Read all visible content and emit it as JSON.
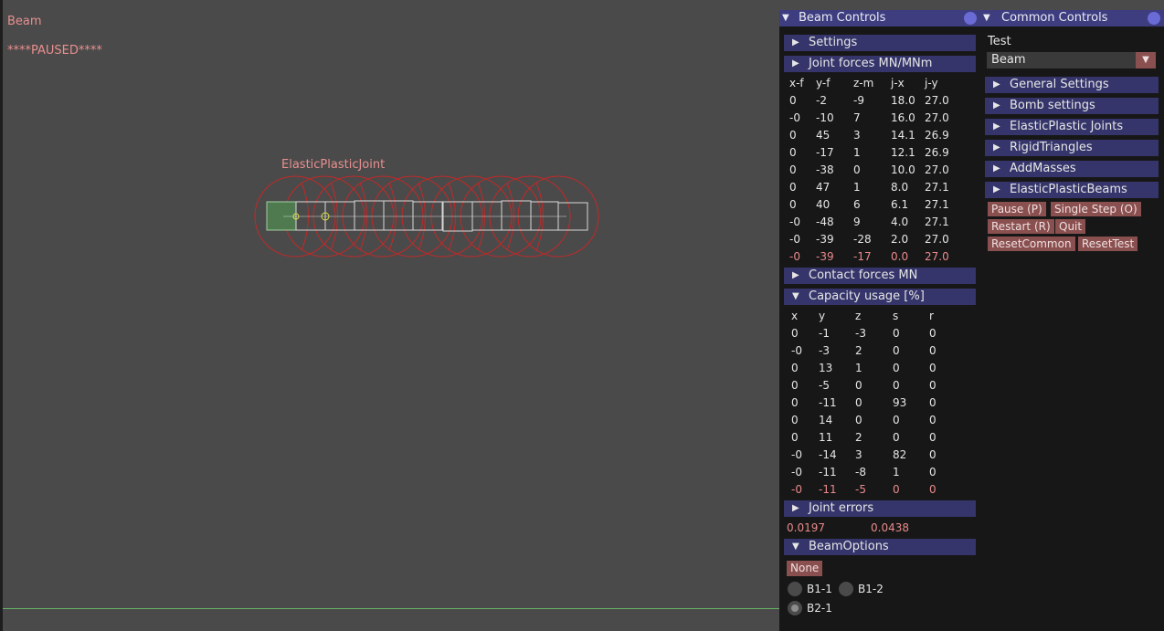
{
  "overlay": {
    "scene_label": "Beam",
    "paused_label": "****PAUSED****",
    "joint_label": "ElasticPlasticJoint"
  },
  "beam_controls": {
    "title": "Beam Controls",
    "settings": "Settings",
    "joint_forces": "Joint forces MN/MNm",
    "joint_forces_headers": [
      "x-f",
      "y-f",
      "z-m",
      "j-x",
      "j-y"
    ],
    "joint_forces_rows": [
      [
        "0",
        "-2",
        "-9",
        "18.0",
        "27.0"
      ],
      [
        "-0",
        "-10",
        "7",
        "16.0",
        "27.0"
      ],
      [
        "0",
        "45",
        "3",
        "14.1",
        "26.9"
      ],
      [
        "0",
        "-17",
        "1",
        "12.1",
        "26.9"
      ],
      [
        "0",
        "-38",
        "0",
        "10.0",
        "27.0"
      ],
      [
        "0",
        "47",
        "1",
        "8.0",
        "27.1"
      ],
      [
        "0",
        "40",
        "6",
        "6.1",
        "27.1"
      ],
      [
        "-0",
        "-48",
        "9",
        "4.0",
        "27.1"
      ],
      [
        "-0",
        "-39",
        "-28",
        "2.0",
        "27.0"
      ],
      [
        "-0",
        "-39",
        "-17",
        "0.0",
        "27.0"
      ]
    ],
    "contact_forces": "Contact forces MN",
    "capacity_usage": "Capacity usage [%]",
    "capacity_headers": [
      "x",
      "y",
      "z",
      "s",
      "r"
    ],
    "capacity_rows": [
      [
        "0",
        "-1",
        "-3",
        "0",
        "0"
      ],
      [
        "-0",
        "-3",
        "2",
        "0",
        "0"
      ],
      [
        "0",
        "13",
        "1",
        "0",
        "0"
      ],
      [
        "0",
        "-5",
        "0",
        "0",
        "0"
      ],
      [
        "0",
        "-11",
        "0",
        "93",
        "0"
      ],
      [
        "0",
        "14",
        "0",
        "0",
        "0"
      ],
      [
        "0",
        "11",
        "2",
        "0",
        "0"
      ],
      [
        "-0",
        "-14",
        "3",
        "82",
        "0"
      ],
      [
        "-0",
        "-11",
        "-8",
        "1",
        "0"
      ],
      [
        "-0",
        "-11",
        "-5",
        "0",
        "0"
      ]
    ],
    "joint_errors": "Joint errors",
    "joint_error_values": [
      "0.0197",
      "0.0438"
    ],
    "beam_options": "BeamOptions",
    "none_button": "None",
    "radio_options": [
      "B1-1",
      "B1-2",
      "B2-1"
    ]
  },
  "common_controls": {
    "title": "Common Controls",
    "test_label": "Test",
    "test_value": "Beam",
    "sections": [
      "General Settings",
      "Bomb settings",
      "ElasticPlastic Joints",
      "RigidTriangles",
      "AddMasses",
      "ElasticPlasticBeams"
    ],
    "buttons": [
      "Pause (P)",
      "Single Step (O)",
      "Restart (R)",
      "Quit",
      "ResetCommon",
      "ResetTest"
    ]
  },
  "colors": {
    "background": "#4a4a4a",
    "panel_bg": "#171717",
    "title_bar": "#3d3d80",
    "header_bar": "#35356b",
    "button": "#8a4f4f",
    "highlight_text": "#e98f8f",
    "circles": "#cc2222"
  },
  "icons": {
    "collapse": "triangle-down-icon",
    "expand": "triangle-right-icon",
    "close": "circle-icon",
    "combo": "triangle-down-icon"
  }
}
